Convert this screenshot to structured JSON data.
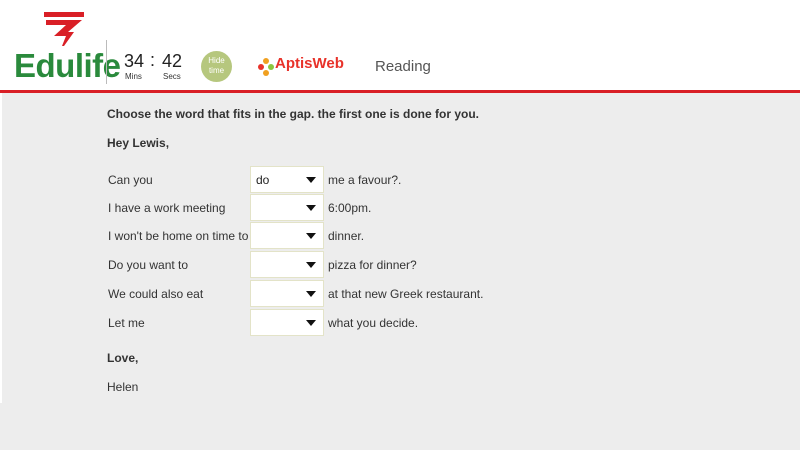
{
  "header": {
    "logo_text": "Edulife",
    "timer": {
      "minutes": "34",
      "separator": ":",
      "seconds": "42",
      "minutes_unit": "Mins",
      "seconds_unit": "Secs"
    },
    "hide_time_line1": "Hide",
    "hide_time_line2": "time",
    "aptis_logo": "AptisWeb",
    "section": "Reading",
    "brand_color": "#d91f26",
    "logo_color": "#2a8a3c"
  },
  "main": {
    "instruction": "Choose the word that fits in the gap. the first one is done for you.",
    "greeting": "Hey Lewis,",
    "sentences": [
      {
        "prefix": "Can you",
        "selected": "do",
        "suffix": "me a favour?."
      },
      {
        "prefix": "I have a work meeting",
        "selected": "",
        "suffix": "6:00pm."
      },
      {
        "prefix": "I won't be home on time to",
        "selected": "",
        "suffix": "dinner."
      },
      {
        "prefix": "Do you want to",
        "selected": "",
        "suffix": "pizza for dinner?"
      },
      {
        "prefix": "We could also eat",
        "selected": "",
        "suffix": "at that new Greek restaurant."
      },
      {
        "prefix": "Let me",
        "selected": "",
        "suffix": "what you decide."
      }
    ],
    "closing": "Love,",
    "signature": "Helen"
  }
}
